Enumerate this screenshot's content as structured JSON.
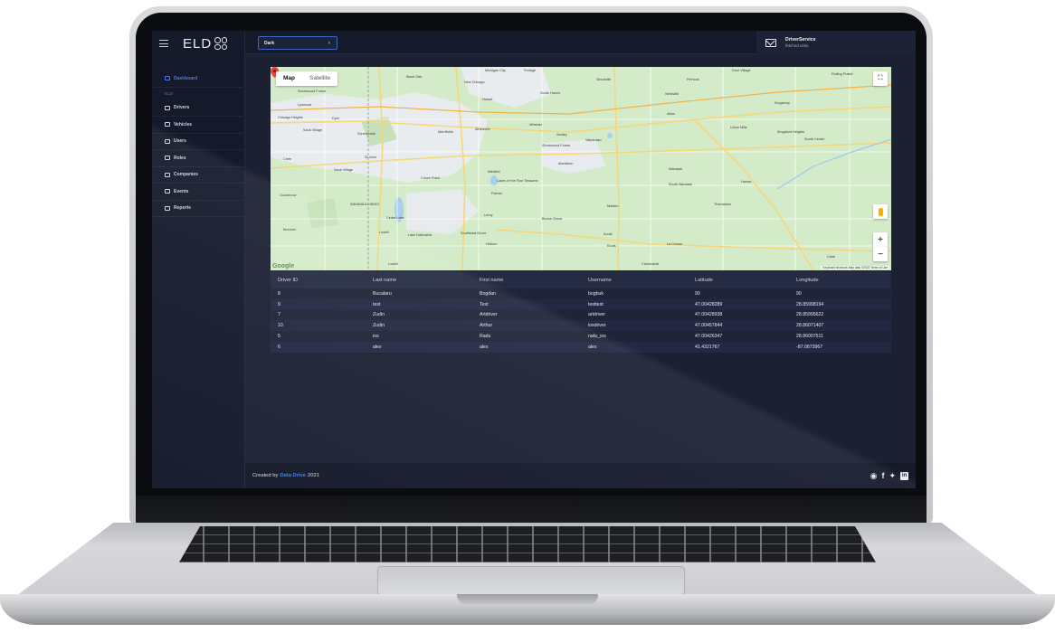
{
  "brand": {
    "logo_text": "ELD"
  },
  "topbar": {
    "theme_value": "Dark"
  },
  "notification": {
    "title": "DriverService",
    "subtitle": "fetched units"
  },
  "sidebar": {
    "section_label": "ELD",
    "items": [
      {
        "label": "Dashboard",
        "icon": "home-icon"
      },
      {
        "label": "Drivers",
        "icon": "user-icon"
      },
      {
        "label": "Vehicles",
        "icon": "truck-icon"
      },
      {
        "label": "Users",
        "icon": "users-icon"
      },
      {
        "label": "Roles",
        "icon": "role-icon"
      },
      {
        "label": "Companies",
        "icon": "briefcase-icon"
      },
      {
        "label": "Events",
        "icon": "calendar-icon"
      },
      {
        "label": "Reports",
        "icon": "report-icon"
      }
    ]
  },
  "map": {
    "tab_map": "Map",
    "tab_satellite": "Satellite",
    "zoom_in": "+",
    "zoom_out": "−",
    "attribution": "Keyboard shortcuts   Map data ©2022   Terms of Use",
    "google": "Google",
    "labels": {
      "michigan_city": "Michigan City",
      "portage": "Portage",
      "chesterton": "Chesterton",
      "black_oak": "Black Oak",
      "hobart": "Hobart",
      "south_haven": "South Haven",
      "valparaiso": "Valparaiso",
      "wheeler": "Wheeler",
      "sedley": "Sedley",
      "shorewood": "Shorewood Forest",
      "aberdeen": "Aberdeen",
      "crown_point": "Crown Point",
      "st_john": "St John",
      "winfield": "Winfield",
      "lakes": "Lakes of the Four Seasons",
      "palmer": "Palmer",
      "wanatah": "Wanatah",
      "south_wanatah": "South Wanatah",
      "westville": "Westville",
      "kingsbury": "Kingsbury",
      "union_mills": "Union Mills",
      "kingsford": "Kingsford Heights",
      "south_center": "South Center",
      "hanna": "Hanna",
      "thomaston": "Thomaston",
      "malden": "Malden",
      "boone_grove": "Boone Grove",
      "leroy": "Leroy",
      "cedar_lake": "Cedar Lake",
      "lowell": "Lowell",
      "hebron": "Hebron",
      "kouts": "Kouts",
      "la_crosse": "La Crosse",
      "clanricarde": "Clanricarde",
      "chicago_heights": "Chicago Heights",
      "sauk_village": "Sauk Village",
      "lynwood": "Lynwood",
      "dyer": "Dyer",
      "schererville": "Schererville",
      "merrillville": "Merrillville",
      "ainsworth": "Ainsworth",
      "goodenow": "Goodenow",
      "beecher": "Beecher",
      "crete": "Crete",
      "lake_dalecarlia": "Lake Dalecarlia",
      "southeast_grove": "Southeast Grove",
      "rolling_prairie": "Rolling Prairie",
      "new_chicago": "New Chicago",
      "woodville": "Woodville",
      "pinhook": "Pinhook",
      "door_village": "Door Village",
      "alida": "Alida",
      "indiana_illinois": "INDIANA ILLINOIS"
    }
  },
  "table": {
    "headers": [
      "Driver ID",
      "Last name",
      "First name",
      "Username",
      "Latitude",
      "Longitude"
    ],
    "rows": [
      [
        "8",
        "Bucataru",
        "Bogdan",
        "bogbuk",
        "90",
        "90"
      ],
      [
        "9",
        "test",
        "Test",
        "testtest",
        "47.00428289",
        "28.85998194"
      ],
      [
        "7",
        "Zudin",
        "Artdriver",
        "artdriver",
        "47.00428938",
        "28.85995622"
      ],
      [
        "10",
        "Zudin",
        "Arthur",
        "iosdriver",
        "47.00457844",
        "28.86071407"
      ],
      [
        "5",
        "ios",
        "Radu",
        "radu_ios",
        "47.00426347",
        "28.86007511"
      ],
      [
        "6",
        "alex",
        "alex",
        "alex",
        "41.4321767",
        "-87.0873967"
      ]
    ]
  },
  "footer": {
    "prefix": "Created by",
    "link": "Data Drive",
    "year": "2021"
  },
  "colors": {
    "accent": "#4a7bd8",
    "screen_bg": "#1b2033",
    "sidebar_bg": "#151a2b"
  }
}
